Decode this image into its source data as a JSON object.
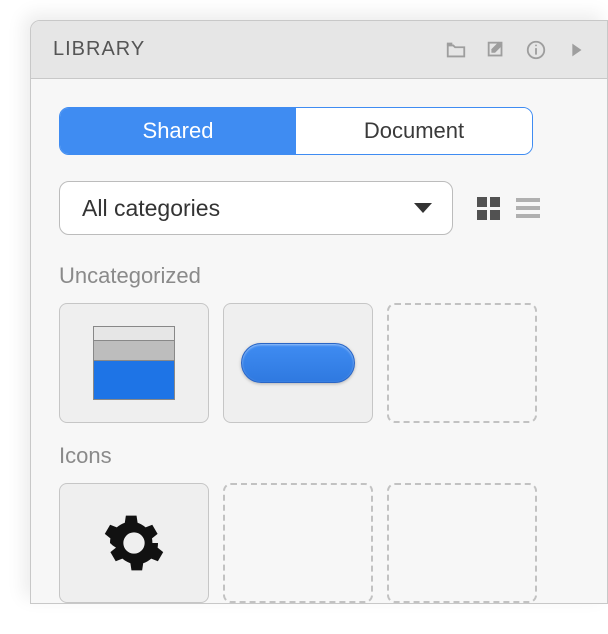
{
  "header": {
    "title": "LIBRARY"
  },
  "tabs": {
    "shared": "Shared",
    "document": "Document",
    "active": "shared"
  },
  "filter": {
    "selected": "All categories"
  },
  "sections": {
    "uncategorized": {
      "title": "Uncategorized"
    },
    "icons": {
      "title": "Icons"
    }
  }
}
